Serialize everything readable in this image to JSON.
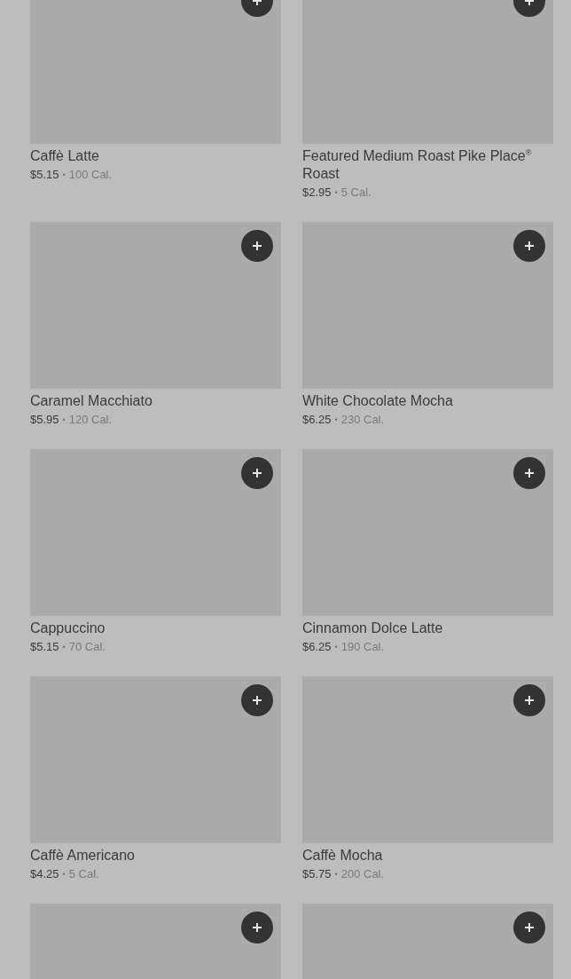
{
  "items": [
    {
      "kind": "product",
      "name": "Caffè Latte",
      "price": "$5.15",
      "separator": "•",
      "calories": "100 Cal."
    },
    {
      "kind": "product",
      "name": "Featured Medium Roast Pike Place$^{®}$ Roast",
      "price": "$2.95",
      "separator": "•",
      "calories": "5 Cal."
    },
    {
      "kind": "product",
      "name": "Caramel Macchiato",
      "price": "$5.95",
      "separator": "•",
      "calories": "120 Cal."
    },
    {
      "kind": "product",
      "name": "White Chocolate Mocha",
      "price": "$6.25",
      "separator": "•",
      "calories": "230 Cal."
    },
    {
      "kind": "product",
      "name": "Cappuccino",
      "price": "$5.15",
      "separator": "•",
      "calories": "70 Cal."
    },
    {
      "kind": "product",
      "name": "Cinnamon Dolce Latte",
      "price": "$6.25",
      "separator": "•",
      "calories": "190 Cal."
    },
    {
      "kind": "product",
      "name": "Caffè Americano",
      "price": "$4.25",
      "separator": "•",
      "calories": "5 Cal."
    },
    {
      "kind": "product",
      "name": "Caffè Mocha",
      "price": "$5.75",
      "separator": "•",
      "calories": "200 Cal."
    },
    {
      "kind": "picture"
    },
    {
      "kind": "picture"
    }
  ]
}
